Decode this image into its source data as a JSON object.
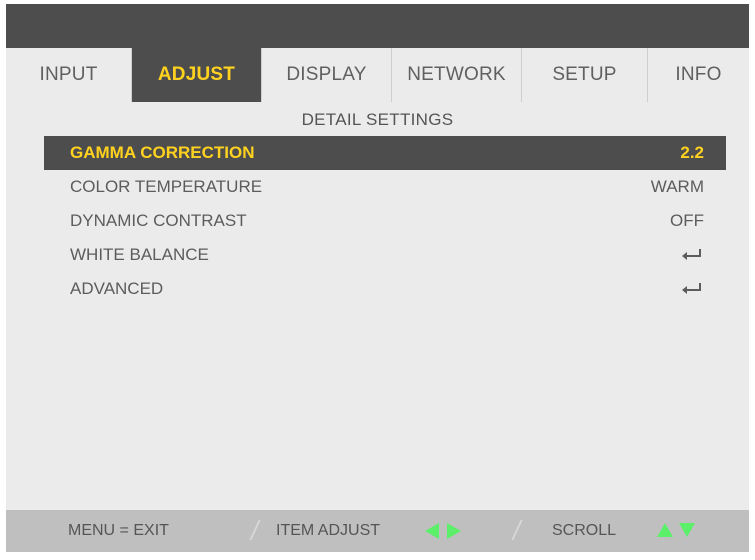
{
  "tabs": [
    {
      "label": "INPUT",
      "active": false
    },
    {
      "label": "ADJUST",
      "active": true
    },
    {
      "label": "DISPLAY",
      "active": false
    },
    {
      "label": "NETWORK",
      "active": false
    },
    {
      "label": "SETUP",
      "active": false
    },
    {
      "label": "INFO",
      "active": false
    }
  ],
  "section_title": "DETAIL SETTINGS",
  "settings": [
    {
      "label": "GAMMA CORRECTION",
      "value": "2.2",
      "selected": true
    },
    {
      "label": "COLOR TEMPERATURE",
      "value": "WARM",
      "selected": false
    },
    {
      "label": "DYNAMIC CONTRAST",
      "value": "OFF",
      "selected": false
    },
    {
      "label": "WHITE BALANCE",
      "icon": "enter-icon",
      "selected": false
    },
    {
      "label": "ADVANCED",
      "icon": "enter-icon",
      "selected": false
    }
  ],
  "footer": {
    "menu_hint": "MENU = EXIT",
    "adjust_hint": "ITEM ADJUST",
    "scroll_hint": "SCROLL"
  },
  "colors": {
    "accent_text": "#ffd21f",
    "bar_dark": "#4d4d4d",
    "background": "#ebebeb",
    "footer": "#bfbfbf",
    "arrow_green": "#5cf06a"
  }
}
